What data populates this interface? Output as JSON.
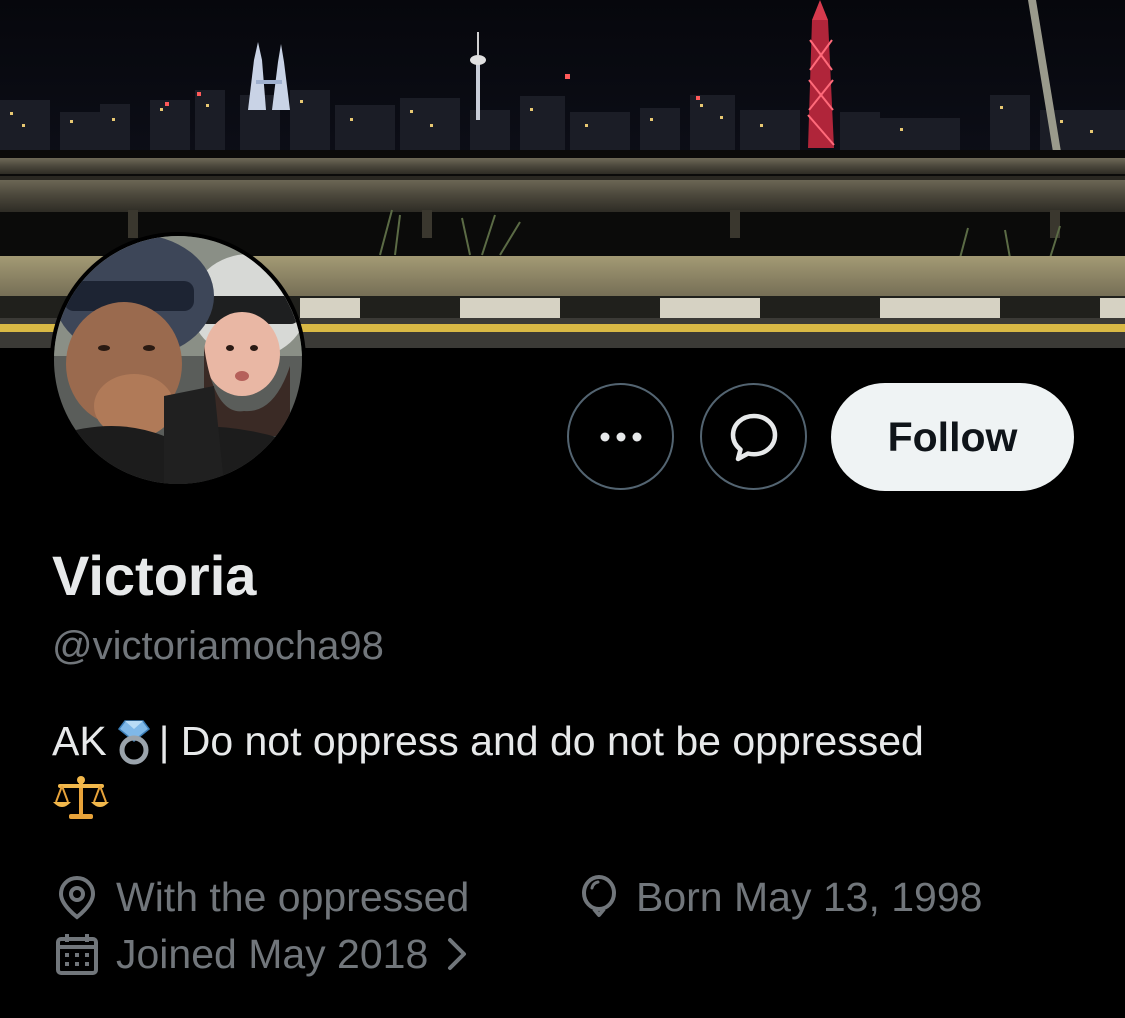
{
  "profile": {
    "display_name": "Victoria",
    "handle": "@victoriamocha98",
    "bio_prefix": "AK",
    "bio_text": "| Do not oppress and do not be oppressed",
    "bio_emojis": [
      "ring-emoji",
      "balance-scale-emoji"
    ]
  },
  "actions": {
    "more_icon": "more-icon",
    "message_icon": "message-icon",
    "follow_label": "Follow"
  },
  "meta": {
    "location": "With the oppressed",
    "birthday": "Born May 13, 1998",
    "joined": "Joined May 2018",
    "location_icon": "location-pin-icon",
    "birthday_icon": "balloon-icon",
    "joined_icon": "calendar-icon"
  },
  "colors": {
    "background": "#000000",
    "primary_text": "#e7e9ea",
    "secondary_text": "#71767b",
    "button_border": "#536471",
    "follow_bg": "#eff3f4",
    "follow_text": "#0f1419"
  }
}
